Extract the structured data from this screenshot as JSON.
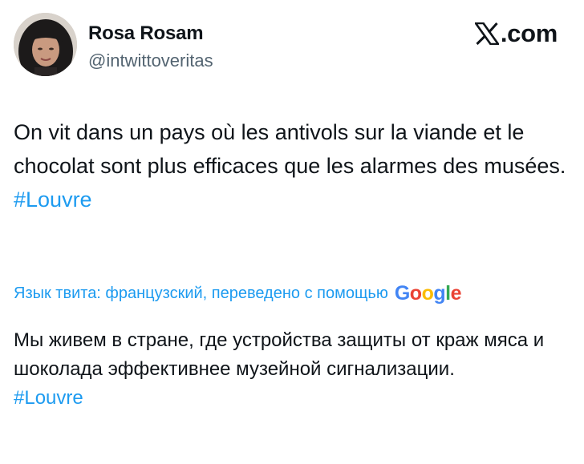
{
  "author": {
    "display_name": "Rosa Rosam",
    "handle": "@intwittoveritas"
  },
  "brand": {
    "icon": "x-logo-icon",
    "label": ".com"
  },
  "tweet": {
    "text": "On vit dans un pays où les antivols sur la viande et le chocolat sont plus efficaces que les alarmes des musées.",
    "hashtag": "#Louvre"
  },
  "translation": {
    "label": "Язык твита: французский, переведено с помощью",
    "provider_letters": [
      "G",
      "o",
      "o",
      "g",
      "l",
      "e"
    ],
    "text": "Мы живем в стране, где устройства защиты от краж мяса и шоколада эффективнее музейной сигнализации.",
    "hashtag": "#Louvre"
  },
  "colors": {
    "link": "#1d9bf0",
    "secondary_text": "#536471",
    "primary_text": "#0f1419"
  }
}
